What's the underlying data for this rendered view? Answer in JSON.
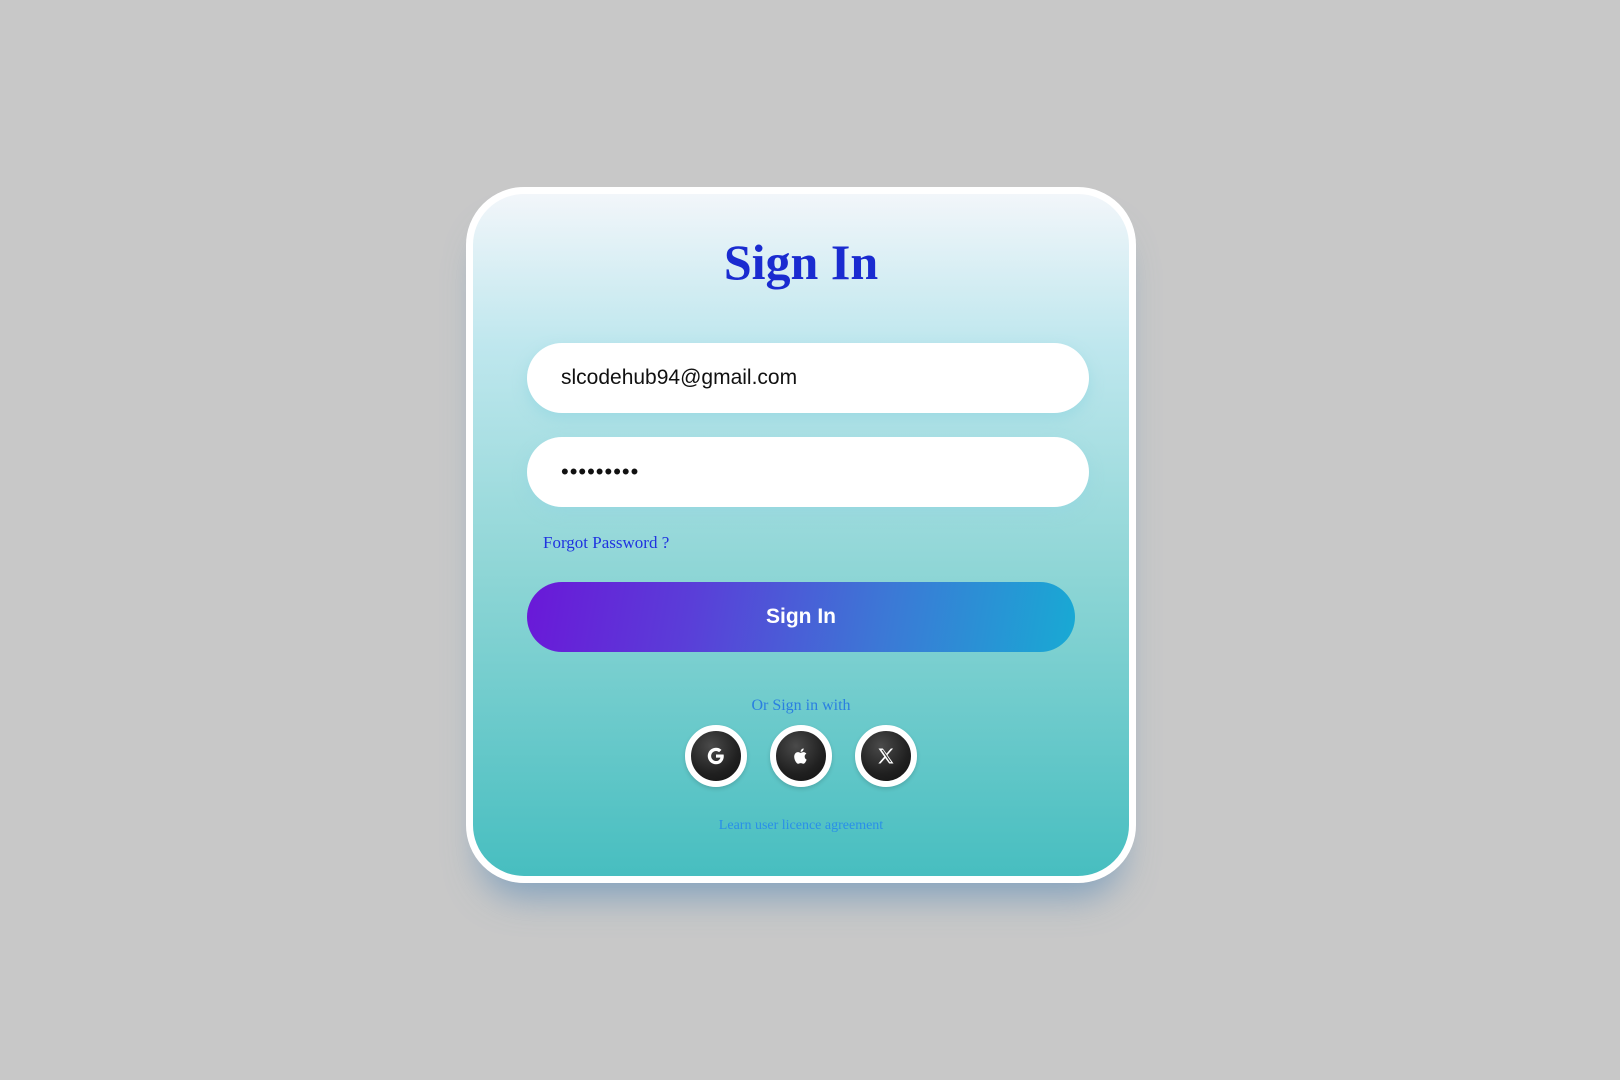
{
  "title": "Sign In",
  "form": {
    "email_value": "slcodehub94@gmail.com",
    "password_value": "•••••••••",
    "forgot_label": "Forgot Password ?",
    "submit_label": "Sign In"
  },
  "alt_signin": {
    "label": "Or Sign in with",
    "providers": [
      {
        "name": "Google",
        "icon": "google-icon"
      },
      {
        "name": "Apple",
        "icon": "apple-icon"
      },
      {
        "name": "X",
        "icon": "x-icon"
      }
    ]
  },
  "footer": {
    "licence_link": "Learn user licence agreement"
  },
  "colors": {
    "background": "#c8c8c8",
    "title": "#1a2bd0",
    "button_start": "#6a18d8",
    "button_end": "#18aad4",
    "link": "#1f33e0",
    "card_bottom": "#47bec0"
  }
}
